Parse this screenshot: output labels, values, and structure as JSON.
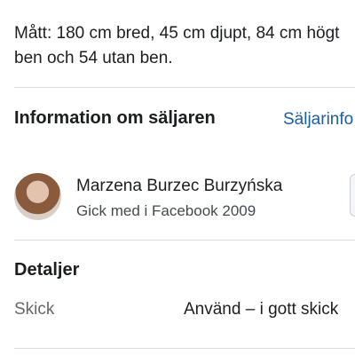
{
  "description": {
    "line1": "Mått: 180 cm bred, 45 cm djupt, 84 cm högt",
    "line2": "ben och 54 utan ben."
  },
  "seller_section": {
    "title": "Information om säljaren",
    "link_label": "Säljarinfo"
  },
  "seller": {
    "name": "Marzena Burzec Burzyńska",
    "meta": "Gick med i Facebook 2009"
  },
  "details": {
    "title": "Detaljer",
    "rows": [
      {
        "label": "Skick",
        "value": "Använd – i gott skick"
      }
    ]
  }
}
